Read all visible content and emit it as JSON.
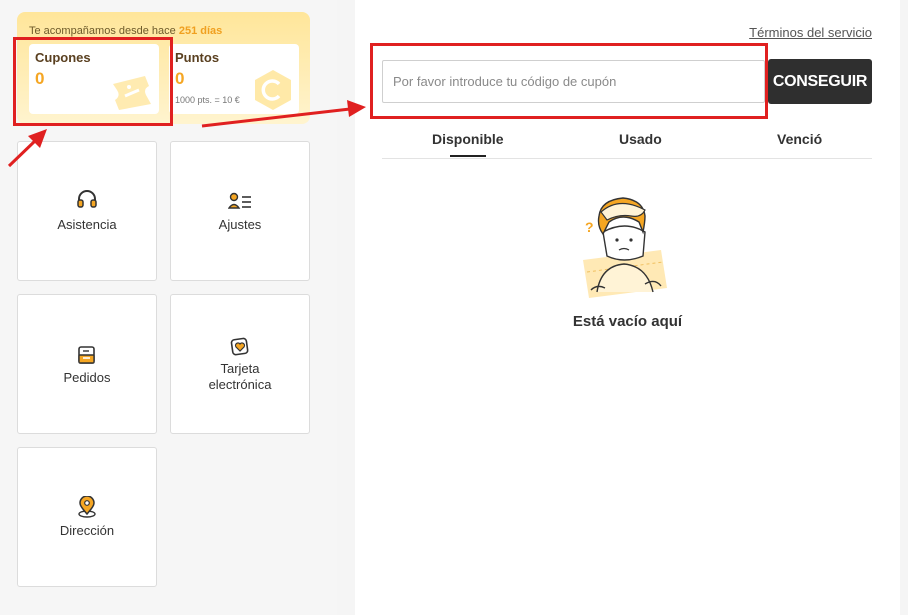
{
  "promo": {
    "prefix": "Te acompañamos desde hace",
    "days": "251 días"
  },
  "stats": {
    "coupons": {
      "title": "Cupones",
      "value": "0"
    },
    "points": {
      "title": "Puntos",
      "value": "0",
      "note": "1000 pts. = 10 €"
    }
  },
  "tiles": [
    {
      "label": "Asistencia",
      "icon": "headset-icon"
    },
    {
      "label": "Ajustes",
      "icon": "user-settings-icon"
    },
    {
      "label": "Pedidos",
      "icon": "orders-icon"
    },
    {
      "label": "Tarjeta electrónica",
      "icon": "ecard-icon"
    },
    {
      "label": "Dirección",
      "icon": "location-pin-icon"
    }
  ],
  "coupon_panel": {
    "terms_link": "Términos del servicio",
    "input_placeholder": "Por favor introduce tu código de cupón",
    "button_label": "CONSEGUIR",
    "tabs": [
      "Disponible",
      "Usado",
      "Venció"
    ],
    "active_tab": "Disponible",
    "empty_message": "Está vacío aquí"
  },
  "colors": {
    "accent": "#f5a623",
    "highlight": "#e02020",
    "button": "#2f2f2f"
  }
}
